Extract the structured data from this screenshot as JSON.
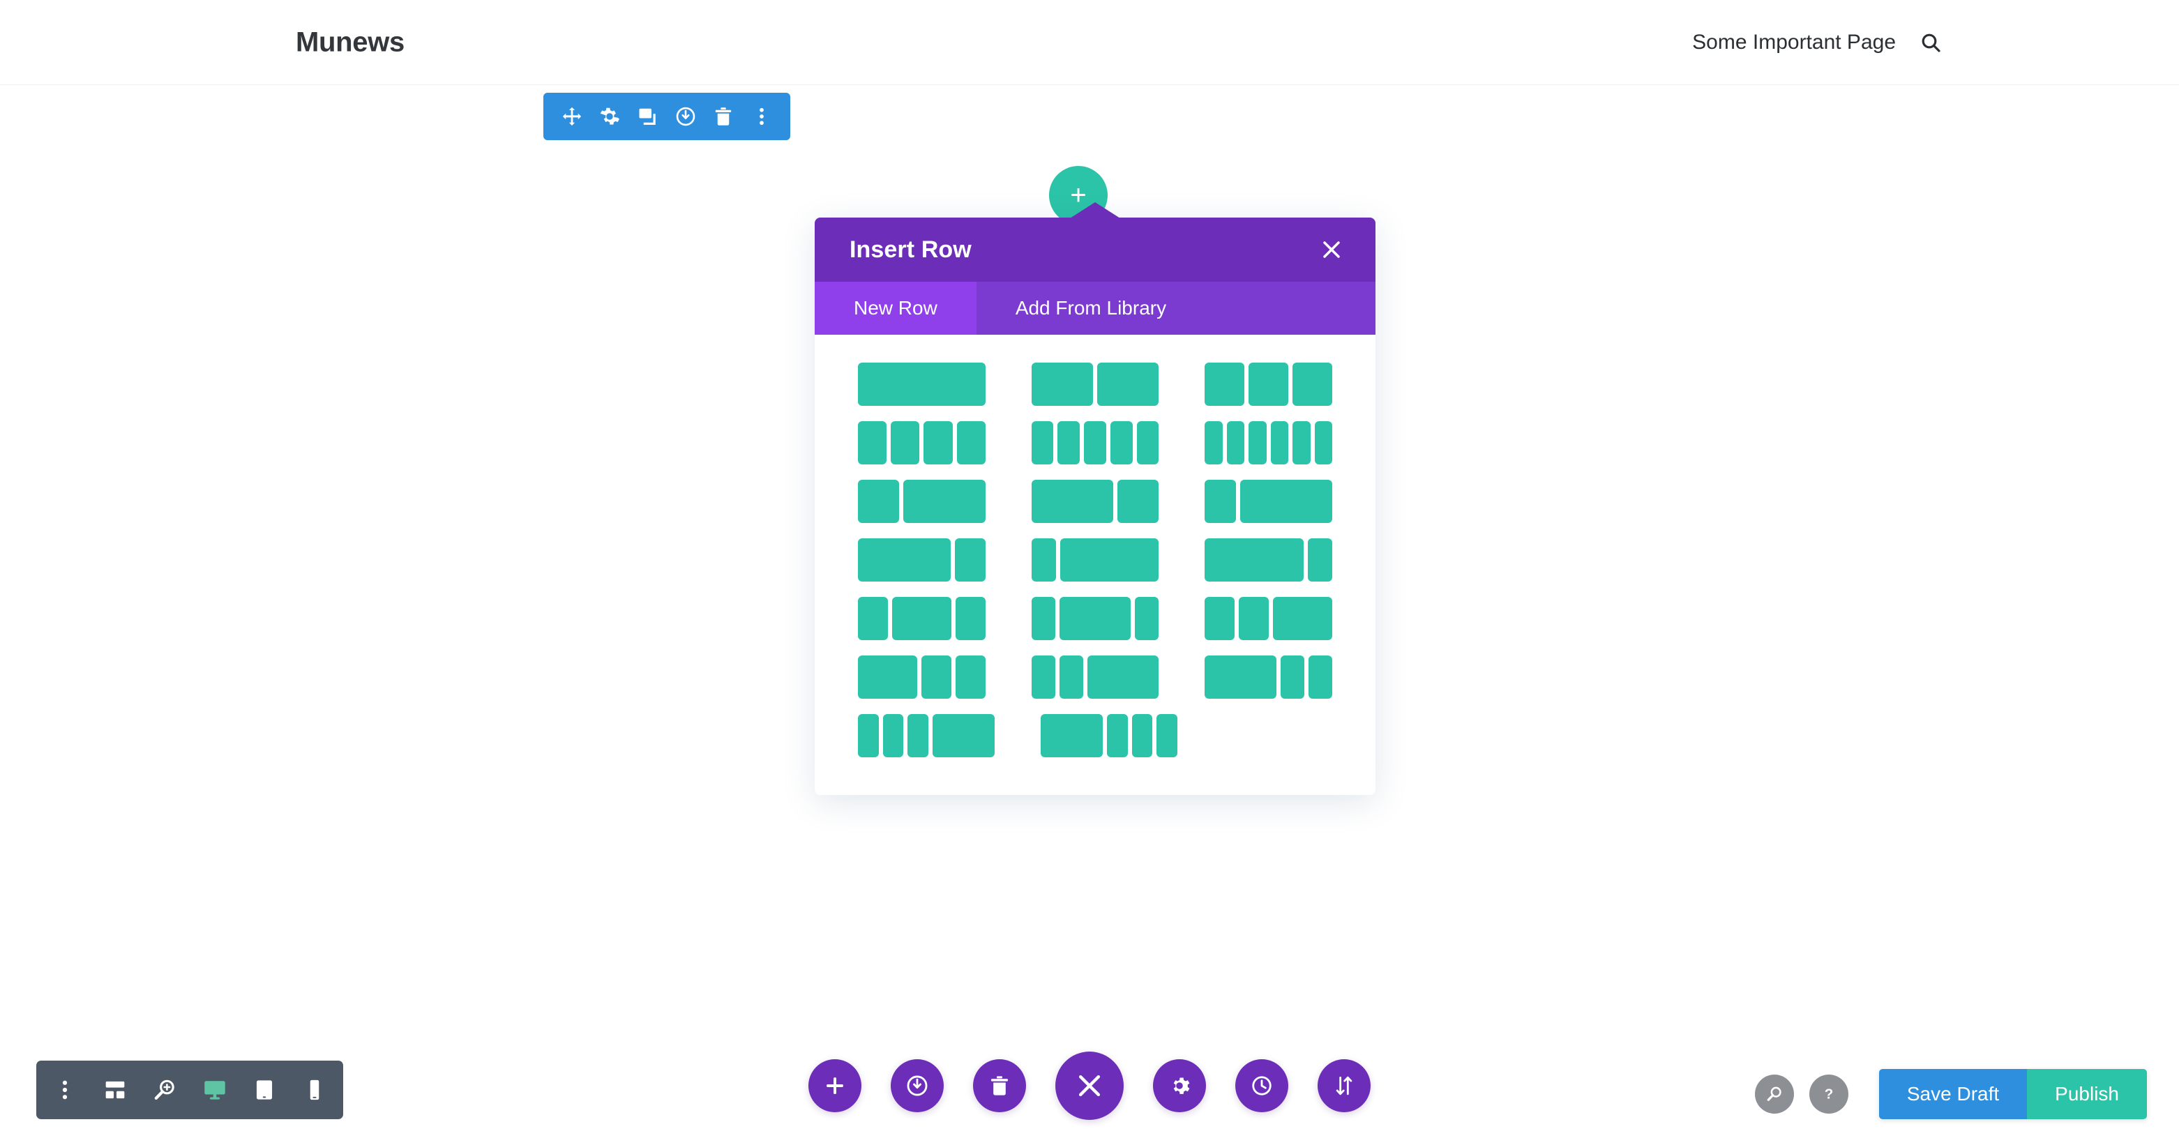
{
  "header": {
    "logo": "Munews",
    "nav_link": "Some Important Page",
    "search_icon": "search-icon"
  },
  "section_toolbar": {
    "icons": [
      "move-icon",
      "gear-icon",
      "duplicate-icon",
      "power-icon",
      "trash-icon",
      "more-options-icon"
    ],
    "color": "#2d8fdd"
  },
  "add_row_circle": {
    "label": "+",
    "color": "#2cc4a8"
  },
  "modal": {
    "title": "Insert Row",
    "close_icon": "close-icon",
    "header_color": "#6c2eb9",
    "tabs": [
      {
        "label": "New Row",
        "active": true
      },
      {
        "label": "Add From Library",
        "active": false
      }
    ],
    "block_color": "#2cc4a8",
    "layouts": [
      [
        [
          1
        ],
        [
          1,
          1
        ],
        [
          1,
          1,
          1
        ]
      ],
      [
        [
          1,
          1,
          1,
          1
        ],
        [
          1,
          1,
          1,
          1,
          1
        ],
        [
          1,
          1,
          1,
          1,
          1,
          1
        ]
      ],
      [
        [
          1,
          2
        ],
        [
          2,
          1
        ],
        [
          1,
          3
        ]
      ],
      [
        [
          3,
          1
        ],
        [
          1,
          4
        ],
        [
          4,
          1
        ]
      ],
      [
        [
          1,
          2,
          1
        ],
        [
          1,
          3,
          1
        ],
        [
          1,
          1,
          2
        ]
      ],
      [
        [
          2,
          1,
          1
        ],
        [
          1,
          1,
          3
        ],
        [
          3,
          1,
          1
        ]
      ],
      [
        [
          1,
          1,
          1,
          3
        ],
        [
          3,
          1,
          1,
          1
        ]
      ]
    ]
  },
  "viewport_toolbar": {
    "icons": [
      "more-vertical-icon",
      "wireframe-icon",
      "zoom-icon",
      "desktop-icon",
      "tablet-icon",
      "phone-icon"
    ],
    "active_icon": "desktop-icon",
    "background": "#4c5866",
    "active_color": "#5fc4a3"
  },
  "builder_actions": {
    "buttons": [
      {
        "icon": "plus-icon",
        "large": false
      },
      {
        "icon": "power-icon",
        "large": false
      },
      {
        "icon": "trash-icon",
        "large": false
      },
      {
        "icon": "close-icon",
        "large": true
      },
      {
        "icon": "gear-icon",
        "large": false
      },
      {
        "icon": "history-icon",
        "large": false
      },
      {
        "icon": "sort-icon",
        "large": false
      }
    ],
    "color": "#6c2eb9"
  },
  "publish_area": {
    "search_icon": "search-icon",
    "help_icon": "help-icon",
    "save_draft_label": "Save Draft",
    "publish_label": "Publish",
    "save_color": "#2d8fdd",
    "publish_color": "#2cc4a8"
  }
}
